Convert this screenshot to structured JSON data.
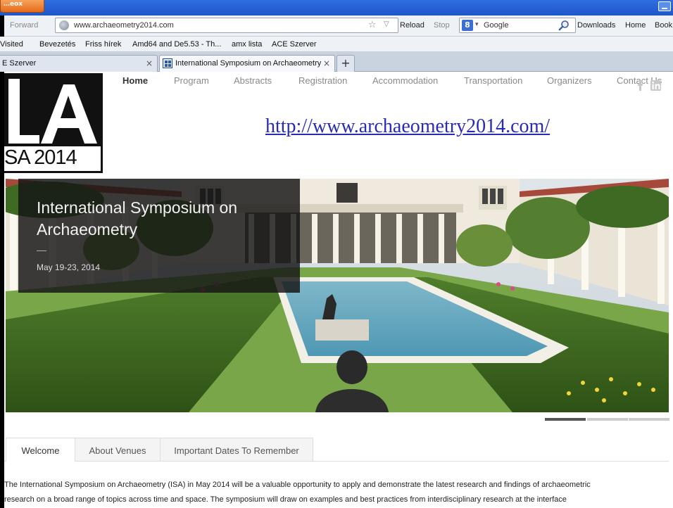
{
  "browser": {
    "app_button_label": "…eox",
    "nav": {
      "forward": "Forward",
      "reload": "Reload",
      "stop": "Stop"
    },
    "url": "www.archaeometry2014.com",
    "search_placeholder": "Google",
    "toolbar": {
      "downloads": "Downloads",
      "home": "Home",
      "bookmarks": "Book"
    },
    "bookmarks": [
      "Visited",
      "Bevezetés",
      "Friss hírek",
      "Amd64 and De5.53 - Th...",
      "amx lista",
      "ACE Szerver"
    ],
    "tabs": [
      {
        "label": "E Szerver"
      },
      {
        "label": "International Symposium on Archaeometry"
      }
    ]
  },
  "site": {
    "logo_text": "SA 2014",
    "menu": [
      "Home",
      "Program",
      "Abstracts",
      "Registration",
      "Accommodation",
      "Transportation",
      "Organizers",
      "Contact Us"
    ],
    "big_link": "http://www.archaeometry2014.com/",
    "hero": {
      "title": "International Symposium on Archaeometry",
      "date": "May 19-23, 2014"
    },
    "content_tabs": [
      "Welcome",
      "About Venues",
      "Important Dates To Remember"
    ],
    "intro_line1": "The  International Symposium on Archaeometry (ISA) in May 2014 will be a valuable opportunity to apply and demonstrate the latest research and findings of archaeometric",
    "intro_line2": "research on a broad range of topics across time and space. The symposium will draw on examples and best practices from interdisciplinary research at the interface"
  },
  "colors": {
    "link": "#2a2ab8",
    "titlebar": "#1e56c8",
    "app_button": "#e56a1a"
  }
}
